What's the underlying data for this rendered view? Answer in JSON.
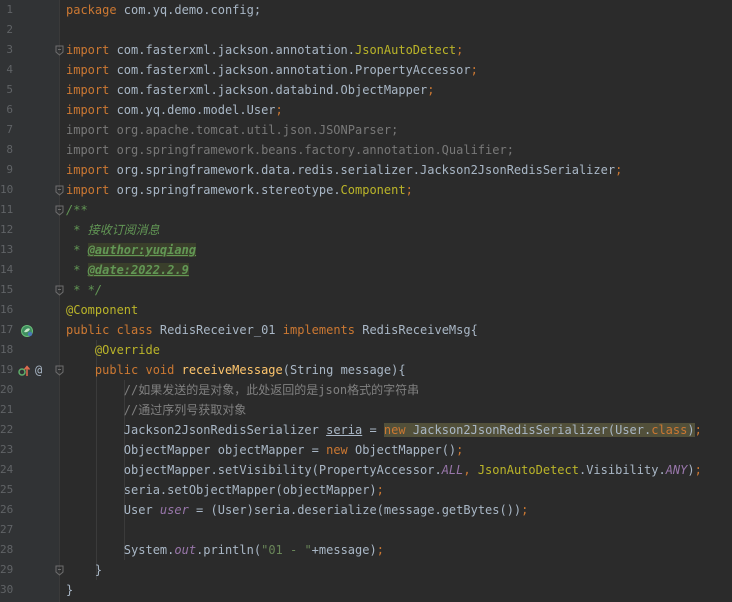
{
  "editor": {
    "language": "Java",
    "lines": [
      {
        "n": "1",
        "tokens": [
          [
            "kw",
            "package "
          ],
          [
            "",
            "com.yq.demo.config;"
          ]
        ]
      },
      {
        "n": "2",
        "tokens": []
      },
      {
        "n": "3",
        "tokens": [
          [
            "kw",
            "import "
          ],
          [
            "",
            "com.fasterxml.jackson.annotation."
          ],
          [
            "cls",
            "JsonAutoDetect"
          ],
          [
            "kw",
            ";"
          ]
        ],
        "fold": true
      },
      {
        "n": "4",
        "tokens": [
          [
            "kw",
            "import "
          ],
          [
            "",
            "com.fasterxml.jackson.annotation.PropertyAccessor"
          ],
          [
            "kw",
            ";"
          ]
        ]
      },
      {
        "n": "5",
        "tokens": [
          [
            "kw",
            "import "
          ],
          [
            "",
            "com.fasterxml.jackson.databind.ObjectMapper"
          ],
          [
            "kw",
            ";"
          ]
        ]
      },
      {
        "n": "6",
        "tokens": [
          [
            "kw",
            "import "
          ],
          [
            "",
            "com.yq.demo.model.User"
          ],
          [
            "kw",
            ";"
          ]
        ]
      },
      {
        "n": "7",
        "tokens": [
          [
            "unused",
            "import org.apache.tomcat.util.json.JSONParser;"
          ]
        ]
      },
      {
        "n": "8",
        "tokens": [
          [
            "unused",
            "import org.springframework.beans.factory.annotation.Qualifier;"
          ]
        ]
      },
      {
        "n": "9",
        "tokens": [
          [
            "kw",
            "import "
          ],
          [
            "",
            "org.springframework.data.redis.serializer.Jackson2JsonRedisSerializer"
          ],
          [
            "kw",
            ";"
          ]
        ]
      },
      {
        "n": "10",
        "tokens": [
          [
            "kw",
            "import "
          ],
          [
            "",
            "org.springframework.stereotype."
          ],
          [
            "cls",
            "Component"
          ],
          [
            "kw",
            ";"
          ]
        ],
        "fold": true
      },
      {
        "n": "11",
        "tokens": [
          [
            "doc",
            "/**"
          ]
        ],
        "fold": true
      },
      {
        "n": "12",
        "tokens": [
          [
            "doc",
            " * 接收订阅消息"
          ]
        ]
      },
      {
        "n": "13",
        "tokens": [
          [
            "doc",
            " * "
          ],
          [
            "doctag",
            "@author:yuqiang"
          ]
        ]
      },
      {
        "n": "14",
        "tokens": [
          [
            "doc",
            " * "
          ],
          [
            "doctag",
            "@date:2022.2.9"
          ]
        ]
      },
      {
        "n": "15",
        "tokens": [
          [
            "doc",
            " * */"
          ]
        ],
        "fold": true
      },
      {
        "n": "16",
        "tokens": [
          [
            "ann",
            "@Component"
          ]
        ]
      },
      {
        "n": "17",
        "tokens": [
          [
            "kw",
            "public class "
          ],
          [
            "",
            "RedisReceiver_01 "
          ],
          [
            "kw",
            "implements "
          ],
          [
            "",
            "RedisReceiveMsg{"
          ]
        ],
        "icon": "spring-bean"
      },
      {
        "n": "18",
        "tokens": [
          [
            "",
            "    "
          ],
          [
            "ann",
            "@Override"
          ]
        ]
      },
      {
        "n": "19",
        "tokens": [
          [
            "",
            "    "
          ],
          [
            "kw",
            "public void "
          ],
          [
            "fn",
            "receiveMessage"
          ],
          [
            "",
            "(String message){"
          ]
        ],
        "icon": "override",
        "fold": true
      },
      {
        "n": "20",
        "tokens": [
          [
            "",
            "        "
          ],
          [
            "cmt",
            "//如果发送的是对象，此处返回的是json格式的字符串"
          ]
        ]
      },
      {
        "n": "21",
        "tokens": [
          [
            "",
            "        "
          ],
          [
            "cmt",
            "//通过序列号获取对象"
          ]
        ]
      },
      {
        "n": "22",
        "tokens": [
          [
            "",
            "        Jackson2JsonRedisSerializer "
          ],
          [
            "ul",
            "seria"
          ],
          [
            "",
            " = "
          ],
          [
            "kw hlw",
            "new"
          ],
          [
            "hlw",
            " Jackson2JsonRedisSerializer(User."
          ],
          [
            "kw hlw",
            "class"
          ],
          [
            "hlw",
            ")"
          ],
          [
            "kw",
            ";"
          ]
        ]
      },
      {
        "n": "23",
        "tokens": [
          [
            "",
            "        ObjectMapper objectMapper = "
          ],
          [
            "kw",
            "new "
          ],
          [
            "",
            "ObjectMapper()"
          ],
          [
            "kw",
            ";"
          ]
        ]
      },
      {
        "n": "24",
        "tokens": [
          [
            "",
            "        objectMapper.setVisibility(PropertyAccessor."
          ],
          [
            "const",
            "ALL"
          ],
          [
            "kw",
            ", "
          ],
          [
            "cls",
            "JsonAutoDetect"
          ],
          [
            "",
            ".Visibility."
          ],
          [
            "const",
            "ANY"
          ],
          [
            "",
            ")"
          ],
          [
            "kw",
            ";"
          ]
        ]
      },
      {
        "n": "25",
        "tokens": [
          [
            "",
            "        seria.setObjectMapper(objectMapper)"
          ],
          [
            "kw",
            ";"
          ]
        ]
      },
      {
        "n": "26",
        "tokens": [
          [
            "",
            "        User "
          ],
          [
            "const",
            "user"
          ],
          [
            "",
            " = (User)seria.deserialize(message.getBytes())"
          ],
          [
            "kw",
            ";"
          ]
        ]
      },
      {
        "n": "27",
        "tokens": []
      },
      {
        "n": "28",
        "tokens": [
          [
            "",
            "        System."
          ],
          [
            "const",
            "out"
          ],
          [
            "",
            ".println("
          ],
          [
            "str",
            "\"01 - \""
          ],
          [
            "",
            "+message)"
          ],
          [
            "kw",
            ";"
          ]
        ]
      },
      {
        "n": "29",
        "tokens": [
          [
            "",
            "    }"
          ]
        ],
        "fold": true
      },
      {
        "n": "30",
        "tokens": [
          [
            "",
            "}"
          ]
        ]
      }
    ]
  },
  "gutter_icons": {
    "line17": "spring-bean-icon",
    "line19": [
      "override-arrow-icon",
      "at-annotation-icon"
    ]
  },
  "colors": {
    "background": "#2b2b2b",
    "gutter": "#313335",
    "keyword": "#cc7832",
    "annotation": "#bbb529",
    "string": "#6a8759",
    "comment": "#808080",
    "doc_comment": "#629755",
    "method": "#ffc66d",
    "field_static": "#9876aa",
    "default": "#a9b7c6",
    "line_number": "#606366"
  }
}
